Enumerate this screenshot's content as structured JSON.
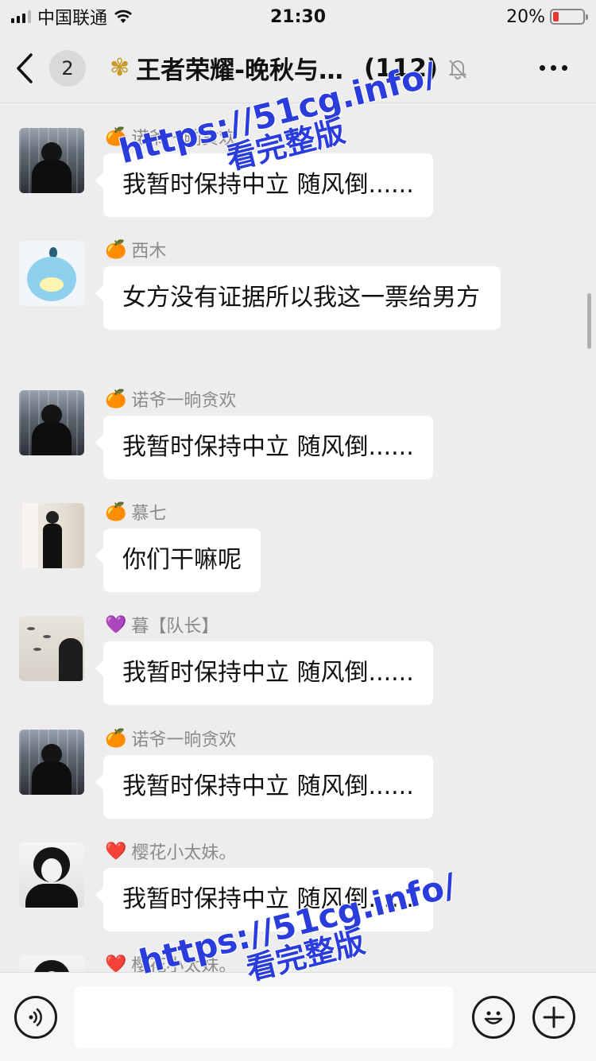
{
  "status_bar": {
    "carrier": "中国联通",
    "time": "21:30",
    "battery_text": "20%",
    "battery_level": 0.2
  },
  "nav": {
    "unread_count": "2",
    "title": "王者荣耀-晚秋与…",
    "member_count": "(112)"
  },
  "messages": [
    {
      "sender_emoji": "🍊",
      "sender": "诺爷一晌贪欢",
      "text": "我暂时保持中立 随风倒......",
      "avatar": "dark-man"
    },
    {
      "sender_emoji": "🍊",
      "sender": "西木",
      "text": "女方没有证据所以我这一票给男方",
      "avatar": "duck"
    },
    {
      "sender_emoji": "🍊",
      "sender": "诺爷一晌贪欢",
      "text": "我暂时保持中立 随风倒......",
      "avatar": "dark-man"
    },
    {
      "sender_emoji": "🍊",
      "sender": "慕七",
      "text": "你们干嘛呢",
      "avatar": "man-curtain"
    },
    {
      "sender_emoji": "💜",
      "sender": "暮【队长】",
      "text": "我暂时保持中立 随风倒......",
      "avatar": "girl-birds"
    },
    {
      "sender_emoji": "🍊",
      "sender": "诺爷一晌贪欢",
      "text": "我暂时保持中立 随风倒......",
      "avatar": "dark-man"
    },
    {
      "sender_emoji": "❤️",
      "sender": "樱花小太妹。",
      "text": "我暂时保持中立 随风倒......",
      "avatar": "bw-girl"
    },
    {
      "sender_emoji": "❤️",
      "sender": "樱花小太妹。",
      "text": "",
      "avatar": "bw-girl"
    }
  ],
  "watermark": {
    "url": "https://51cg.info/",
    "cta": "看完整版"
  },
  "input": {
    "placeholder": ""
  }
}
